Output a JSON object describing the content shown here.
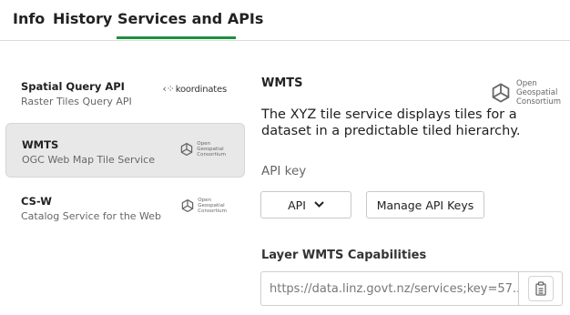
{
  "tabs": [
    {
      "label": "Info"
    },
    {
      "label": "History"
    },
    {
      "label": "Services and APIs"
    }
  ],
  "active_tab": "Services and APIs",
  "services": [
    {
      "name": "Spatial Query API",
      "description": "Raster Tiles Query API",
      "logo_text": "koordinates",
      "icon": "koordinates-logo"
    },
    {
      "name": "WMTS",
      "description": "OGC Web Map Tile Service",
      "logo_text": "Open\nGeospatial\nConsortium",
      "icon": "ogc-logo",
      "active": true
    },
    {
      "name": "CS-W",
      "description": "Catalog Service for the Web",
      "logo_text": "Open\nGeospatial\nConsortium",
      "icon": "ogc-logo"
    }
  ],
  "detail": {
    "title": "WMTS",
    "logo_text": "Open\nGeospatial\nConsortium",
    "description": "The XYZ tile service displays tiles for a dataset in a predictable tiled hierarchy.",
    "api_key_label": "API key",
    "api_button_label": "API",
    "manage_button_label": "Manage API Keys",
    "capabilities_label": "Layer WMTS Capabilities",
    "capabilities_url": "https://data.linz.govt.nz/services;key=57...",
    "copy_icon": "clipboard-icon"
  },
  "colors": {
    "accent": "#1f8e3f",
    "active_bg": "#e8e8e8"
  }
}
